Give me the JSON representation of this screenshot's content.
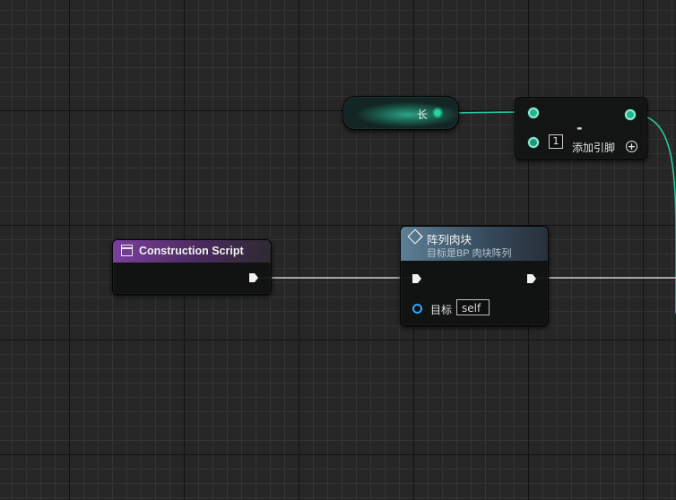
{
  "graph": {
    "variable_node": {
      "label": "长",
      "accent_color": "#28d0a2"
    },
    "math_node": {
      "symbol": "-",
      "default_value": "1",
      "add_pin_label": "添加引脚",
      "add_pin_icon": "plus-circle-icon"
    },
    "construction_node": {
      "title": "Construction Script",
      "icon": "function-entry-icon",
      "header_color": "#7a3f9f"
    },
    "array_node": {
      "title": "阵列肉块",
      "subtitle": "目标是BP 肉块阵列",
      "icon": "function-call-icon",
      "target_label": "目标",
      "target_value": "self",
      "header_color": "#5d7f96"
    },
    "colors": {
      "background": "#262626",
      "wire_exec": "#cfcfcf",
      "wire_float": "#2bc6a0"
    }
  }
}
